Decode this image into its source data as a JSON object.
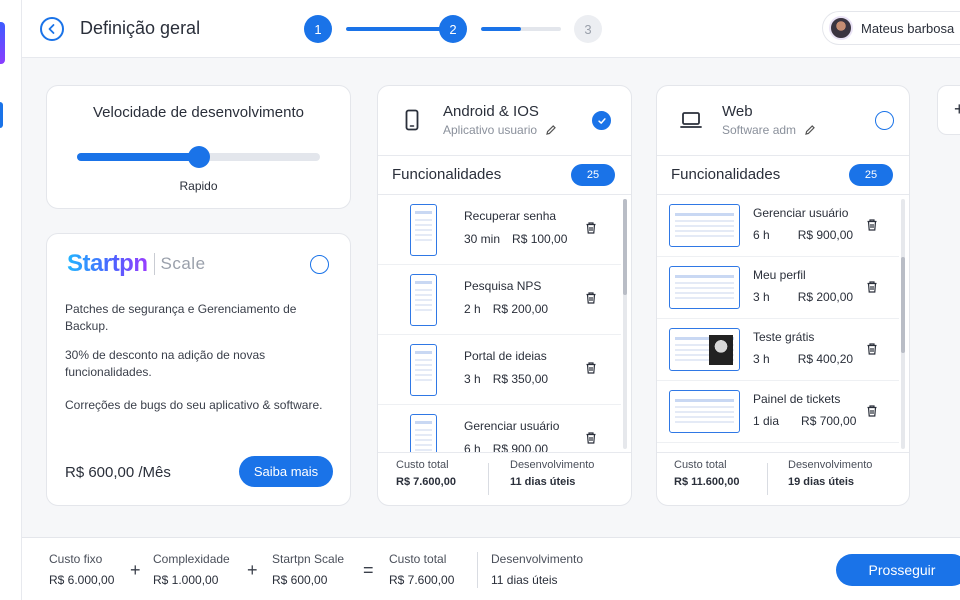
{
  "header": {
    "title": "Definição geral",
    "steps": [
      "1",
      "2",
      "3"
    ],
    "user_name": "Mateus barbosa"
  },
  "speed": {
    "title": "Velocidade de desenvolvimento",
    "level_fraction": 0.5,
    "label": "Rapido"
  },
  "scale": {
    "brand": "Startpn",
    "product": "Scale",
    "selected": false,
    "descriptions": [
      "Patches de segurança e Gerenciamento de Backup.",
      "30% de desconto na adição de novas funcionalidades.",
      "Correções de bugs do seu aplicativo & software."
    ],
    "price": "R$ 600,00 /Mês",
    "button": "Saiba mais"
  },
  "platforms": [
    {
      "name": "Android & IOS",
      "subtitle": "Aplicativo usuario",
      "icon": "smartphone-icon",
      "selected": true,
      "functions_title": "Funcionalidades",
      "count": "25",
      "features": [
        {
          "name": "Recuperar senha",
          "time": "30 min",
          "price": "R$ 100,00"
        },
        {
          "name": "Pesquisa NPS",
          "time": "2 h",
          "price": "R$ 200,00"
        },
        {
          "name": "Portal de ideias",
          "time": "3 h",
          "price": "R$ 350,00"
        },
        {
          "name": "Gerenciar usuário",
          "time": "6 h",
          "price": "R$ 900,00"
        }
      ],
      "total_label": "Custo total",
      "total_value": "R$ 7.600,00",
      "dev_label": "Desenvolvimento",
      "dev_value": "11 dias úteis"
    },
    {
      "name": "Web",
      "subtitle": "Software adm",
      "icon": "laptop-icon",
      "selected": false,
      "functions_title": "Funcionalidades",
      "count": "25",
      "features": [
        {
          "name": "Gerenciar usuário",
          "time": "6 h",
          "price": "R$ 900,00"
        },
        {
          "name": "Meu perfil",
          "time": "3 h",
          "price": "R$ 200,00"
        },
        {
          "name": "Teste grátis",
          "time": "3 h",
          "price": "R$ 400,20"
        },
        {
          "name": "Painel de tickets",
          "time": "1 dia",
          "price": "R$ 700,00"
        }
      ],
      "total_label": "Custo total",
      "total_value": "R$ 11.600,00",
      "dev_label": "Desenvolvimento",
      "dev_value": "19 dias úteis"
    }
  ],
  "summary": {
    "items": [
      {
        "label": "Custo fixo",
        "value": "R$ 6.000,00"
      },
      {
        "label": "Complexidade",
        "value": "R$ 1.000,00"
      },
      {
        "label": "Startpn Scale",
        "value": "R$ 600,00"
      },
      {
        "label": "Custo total",
        "value": "R$ 7.600,00"
      }
    ],
    "operators": [
      "+",
      "+",
      "="
    ],
    "dev_label": "Desenvolvimento",
    "dev_value": "11 dias úteis",
    "button": "Prosseguir"
  },
  "next_card_symbol": "+",
  "colors": {
    "accent": "#1a73e8",
    "background": "#f6f7f9"
  }
}
